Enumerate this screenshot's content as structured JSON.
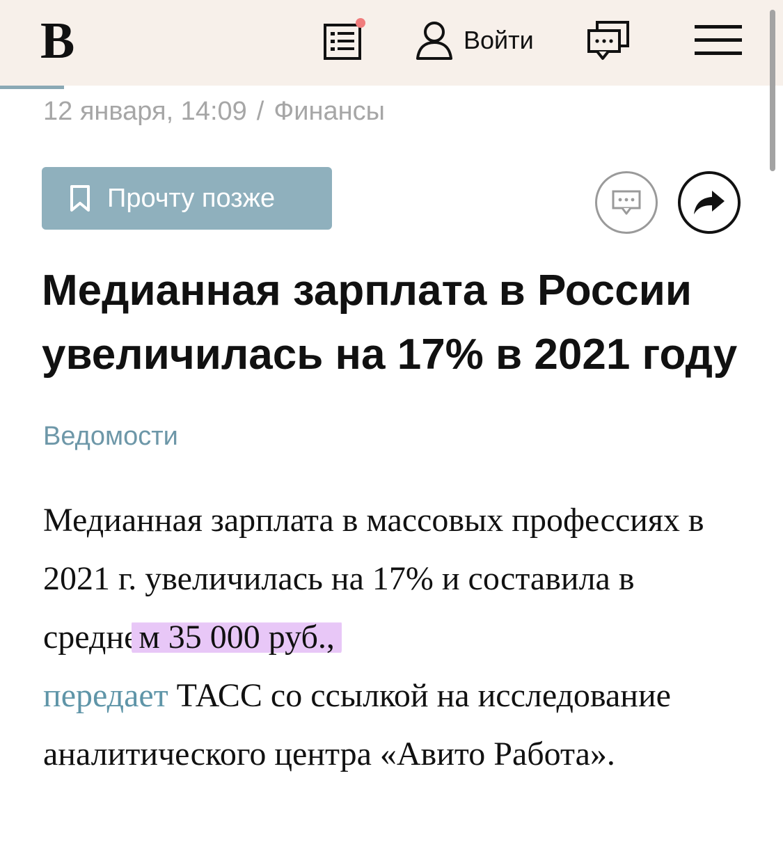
{
  "header": {
    "logo": "В",
    "login_label": "Войти",
    "colors": {
      "background": "#f7f0ea",
      "notification_dot": "#f07c7c"
    },
    "icons": [
      "news-feed-icon",
      "user-icon",
      "chat-icon",
      "menu-icon"
    ]
  },
  "article": {
    "date": "12 января, 14:09",
    "separator": "/",
    "rubric": "Финансы",
    "read_later_label": "Прочту позже",
    "title": "Медианная зарплата в России увеличилась на 17% в 2021 году",
    "source": "Ведомости",
    "body": {
      "part1": "Медианная зарплата в массовых профессиях в 2021 г. увеличилась на 17% и составила в средне",
      "highlight": "м 35 000 руб.,",
      "link": "передает",
      "part2": " ТАСС со ссылкой на исследование аналитического центра «Авито Работа»."
    }
  },
  "colors": {
    "accent_button": "#8fb0bd",
    "link": "#5f95a8",
    "meta_text": "#a6a6a6",
    "highlight": "#e8c7f7"
  }
}
